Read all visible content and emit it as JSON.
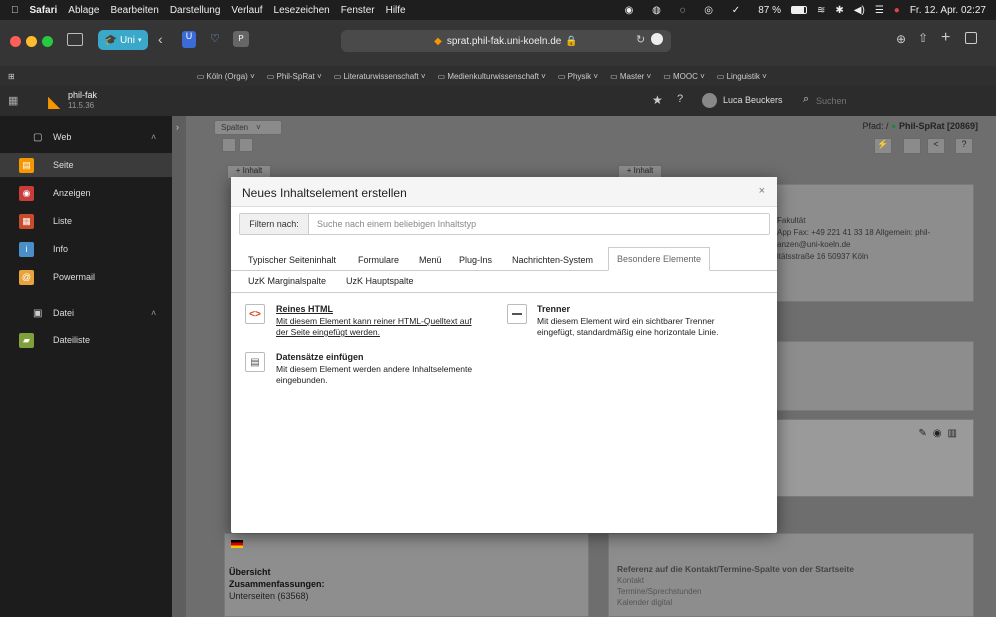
{
  "menubar": {
    "app": "Safari",
    "items": [
      "Ablage",
      "Bearbeiten",
      "Darstellung",
      "Verlauf",
      "Lesezeichen",
      "Fenster",
      "Hilfe"
    ],
    "battery": "87 %",
    "datetime": "Fr. 12. Apr. 02:27"
  },
  "browser": {
    "profile": "Uni",
    "url": "sprat.phil-fak.uni-koeln.de",
    "favorites": [
      "Köln (Orga)",
      "Phil-SpRat",
      "Literaturwissenschaft",
      "Medienkulturwissenschaft",
      "Physik",
      "Master",
      "MOOC",
      "Linguistik"
    ]
  },
  "typo3": {
    "site_name": "phil-fak",
    "version": "11.5.36",
    "user": "Luca Beuckers",
    "search_placeholder": "Suchen"
  },
  "sidebar": {
    "groups": [
      {
        "label": "Web",
        "items": [
          {
            "label": "Seite",
            "color": "#f49700",
            "icon": "page-icon"
          },
          {
            "label": "Anzeigen",
            "color": "#c83c3c",
            "icon": "eye-icon"
          },
          {
            "label": "Liste",
            "color": "#c84c2c",
            "icon": "list-icon"
          },
          {
            "label": "Info",
            "color": "#4a8fc9",
            "icon": "info-icon"
          },
          {
            "label": "Powermail",
            "color": "#e8a33b",
            "icon": "at-icon"
          }
        ]
      },
      {
        "label": "Datei",
        "items": [
          {
            "label": "Dateiliste",
            "color": "#7ea13b",
            "icon": "folder-icon"
          }
        ]
      }
    ]
  },
  "page": {
    "columns_select": "Spalten",
    "path_label": "Pfad: /",
    "path_page": "Phil-SpRat [20869]",
    "add_content": "+ Inhalt",
    "contact_lines": [
      "Fakultät",
      "App Fax: +49 221 41 33 18 Allgemein: phil-",
      "anzen@uni-koeln.de",
      "itätsstraße 16 50937 Köln"
    ],
    "bottom_left": {
      "title": "Übersicht",
      "subtitle": "Zusammenfassungen:",
      "text": "Unterseiten (63568)"
    },
    "bottom_right": {
      "title": "Referenz auf die Kontakt/Termine-Spalte von der Startseite",
      "links": [
        "Kontakt",
        "Termine/Sprechstunden",
        "Kalender digital"
      ]
    }
  },
  "modal": {
    "title": "Neues Inhaltselement erstellen",
    "close": "×",
    "filter_label": "Filtern nach:",
    "filter_placeholder": "Suche nach einem beliebigen Inhaltstyp",
    "tabs_row1": [
      "Typischer Seiteninhalt",
      "Formulare",
      "Menü",
      "Plug-Ins",
      "Nachrichten-System"
    ],
    "active_tab": "Besondere Elemente",
    "tabs_row2": [
      "UzK Marginalspalte",
      "UzK Hauptspalte"
    ],
    "items": [
      {
        "title": "Reines HTML",
        "desc1": "Mit diesem Element kann reiner HTML-Quelltext auf",
        "desc2": "der Seite eingefügt werden.",
        "icon": "html-icon"
      },
      {
        "title": "Trenner",
        "desc1": "Mit diesem Element wird ein sichtbarer Trenner",
        "desc2": "eingefügt, standardmäßig eine horizontale Linie.",
        "icon": "divider-icon"
      },
      {
        "title": "Datensätze einfügen",
        "desc1": "Mit diesem Element werden andere Inhaltselemente",
        "desc2": "eingebunden.",
        "icon": "records-icon"
      }
    ]
  }
}
